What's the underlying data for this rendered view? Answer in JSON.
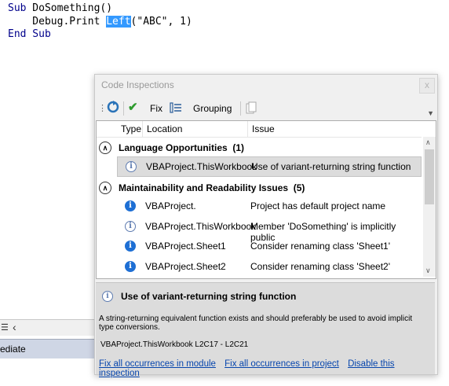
{
  "code": {
    "line1_kw": "Sub",
    "line1_rest": " DoSomething()",
    "line2_a": "    Debug.Print ",
    "line2_sel": "Left",
    "line2_b": "(\"ABC\", 1)",
    "line3_kw": "End Sub"
  },
  "immediate": {
    "label": "ediate"
  },
  "dialog": {
    "title": "Code Inspections",
    "close": "x",
    "toolbar": {
      "fix": "Fix",
      "grouping": "Grouping"
    },
    "columns": [
      "Type",
      "Location",
      "Issue"
    ],
    "groups": [
      {
        "name": "Language Opportunities",
        "count": "(1)",
        "rows": [
          {
            "location": "VBAProject.ThisWorkbook",
            "issue": "Use of variant-returning string function"
          }
        ]
      },
      {
        "name": "Maintainability and Readability Issues",
        "count": "(5)",
        "rows": [
          {
            "location": "VBAProject.",
            "issue": "Project has default project name"
          },
          {
            "location": "VBAProject.ThisWorkbook",
            "issue": "Member 'DoSomething' is implicitly public"
          },
          {
            "location": "VBAProject.Sheet1",
            "issue": "Consider renaming class 'Sheet1'"
          },
          {
            "location": "VBAProject.Sheet2",
            "issue": "Consider renaming class 'Sheet2'"
          }
        ]
      }
    ],
    "detail": {
      "title": "Use of variant-returning string function",
      "description": "A string-returning equivalent function exists and should preferably be used to avoid implicit type conversions.",
      "location": "VBAProject.ThisWorkbook L2C17 - L2C21"
    },
    "links": [
      "Fix all occurrences in module",
      "Fix all occurrences in project",
      "Disable this inspection"
    ]
  }
}
